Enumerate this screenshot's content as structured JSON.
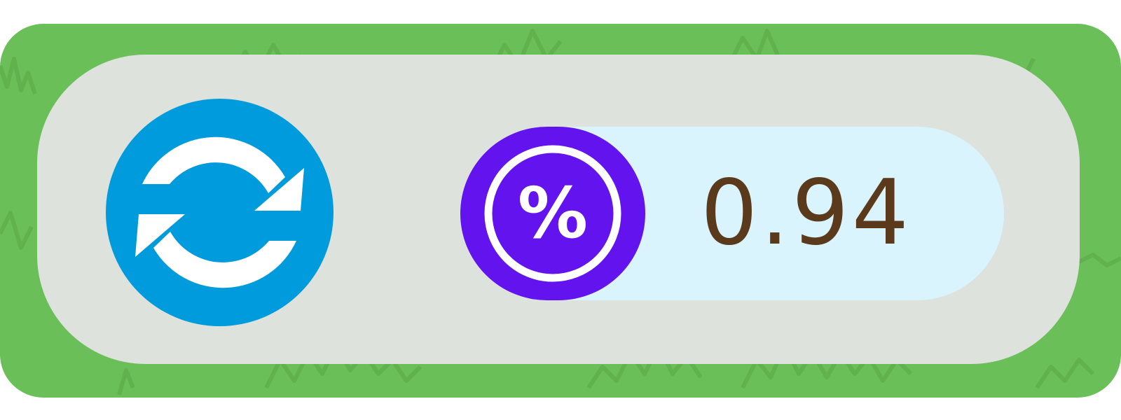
{
  "refresh": {
    "icon": "refresh-icon",
    "color": "#009bdc"
  },
  "stat": {
    "icon": "percent-icon",
    "symbol": "%",
    "badge_color": "#6213ee",
    "value": "0.94",
    "value_color": "#5a3a1a"
  },
  "background": {
    "panel_color": "#6abf58",
    "card_color": "#dee2dc"
  }
}
